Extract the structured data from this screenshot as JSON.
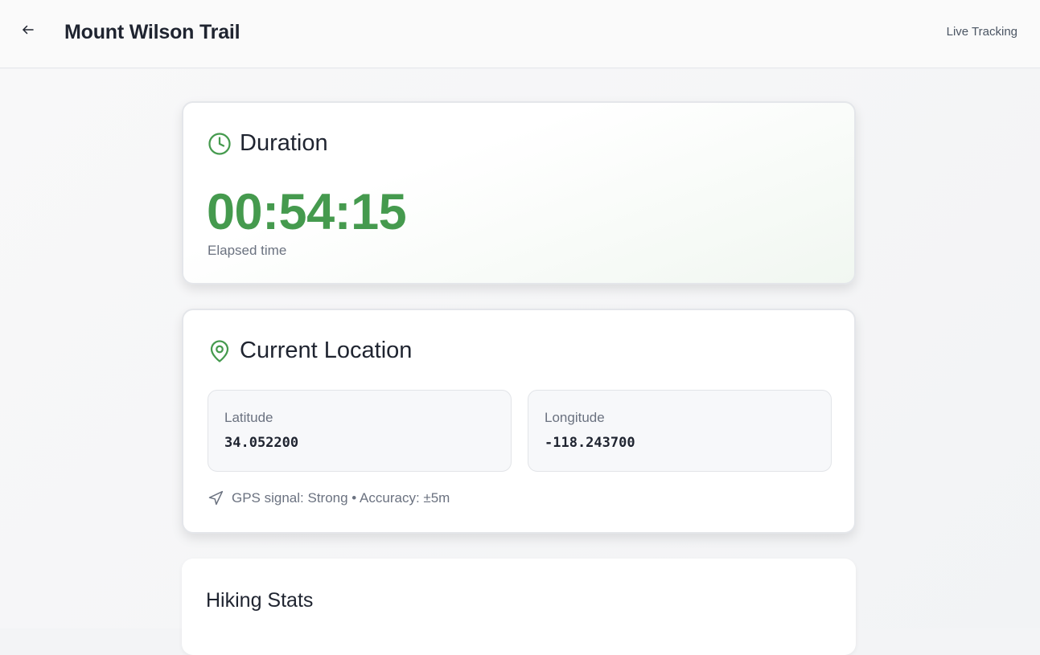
{
  "header": {
    "title": "Mount Wilson Trail",
    "live_tracking": "Live Tracking",
    "back_icon": "arrow-left-icon"
  },
  "duration": {
    "title": "Duration",
    "icon": "clock-icon",
    "value": "00:54:15",
    "label": "Elapsed time"
  },
  "location": {
    "title": "Current Location",
    "icon": "map-pin-icon",
    "latitude_label": "Latitude",
    "latitude_value": "34.052200",
    "longitude_label": "Longitude",
    "longitude_value": "-118.243700",
    "gps_text": "GPS signal: Strong • Accuracy: ±5m",
    "gps_icon": "navigation-icon"
  },
  "stats": {
    "title": "Hiking Stats"
  },
  "colors": {
    "accent": "#459a4e",
    "text": "#1f2430",
    "muted": "#6b7280"
  }
}
